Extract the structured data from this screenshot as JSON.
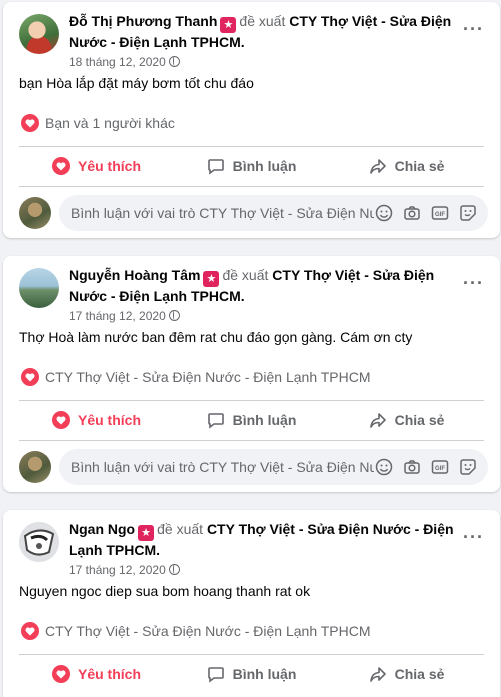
{
  "posts": [
    {
      "author": "Đỗ Thị Phương Thanh",
      "verb": "đề xuất",
      "page": "CTY Thợ Việt - Sửa Điện Nước - Điện Lạnh TPHCM.",
      "date": "18 tháng 12, 2020",
      "text": "bạn Hòa lắp đặt máy bơm tốt chu đáo",
      "reactions": "Bạn và 1 người khác",
      "liked": true,
      "avatar": "woman-flowers"
    },
    {
      "author": "Nguyễn Hoàng Tâm",
      "verb": "đề xuất",
      "page": "CTY Thợ Việt - Sửa Điện Nước - Điện Lạnh TPHCM.",
      "date": "17 tháng 12, 2020",
      "text": "Thợ Hoà làm nước ban đêm rat chu đáo gọn gàng. Cám ơn cty",
      "reactions": "CTY Thợ Việt - Sửa Điện Nước - Điện Lạnh TPHCM",
      "liked": true,
      "avatar": "landscape"
    },
    {
      "author": "Ngan Ngo",
      "verb": "đề xuất",
      "page": "CTY Thợ Việt - Sửa Điện Nước - Điện Lạnh TPHCM.",
      "date": "17 tháng 12, 2020",
      "text": "Nguyen ngoc diep sua bom hoang thanh rat ok",
      "reactions": "CTY Thợ Việt - Sửa Điện Nước - Điện Lạnh TPHCM",
      "liked": true,
      "avatar": "abstract"
    }
  ],
  "actions": {
    "like": "Yêu thích",
    "comment": "Bình luận",
    "share": "Chia sẻ"
  },
  "comment_placeholder": "Bình luận với vai trò CTY Thợ Việt - Sửa Điện Nước - Điện Lạnh TPHCM",
  "icons": [
    "more-icon",
    "globe-icon",
    "recommend-star-icon",
    "heart-icon",
    "comment-icon",
    "share-icon",
    "emoji-icon",
    "camera-icon",
    "gif-icon",
    "sticker-icon"
  ],
  "colors": {
    "like": "#f33e58",
    "secondary": "#65676b",
    "bg": "#f0f2f5",
    "star": "#e0245e"
  }
}
